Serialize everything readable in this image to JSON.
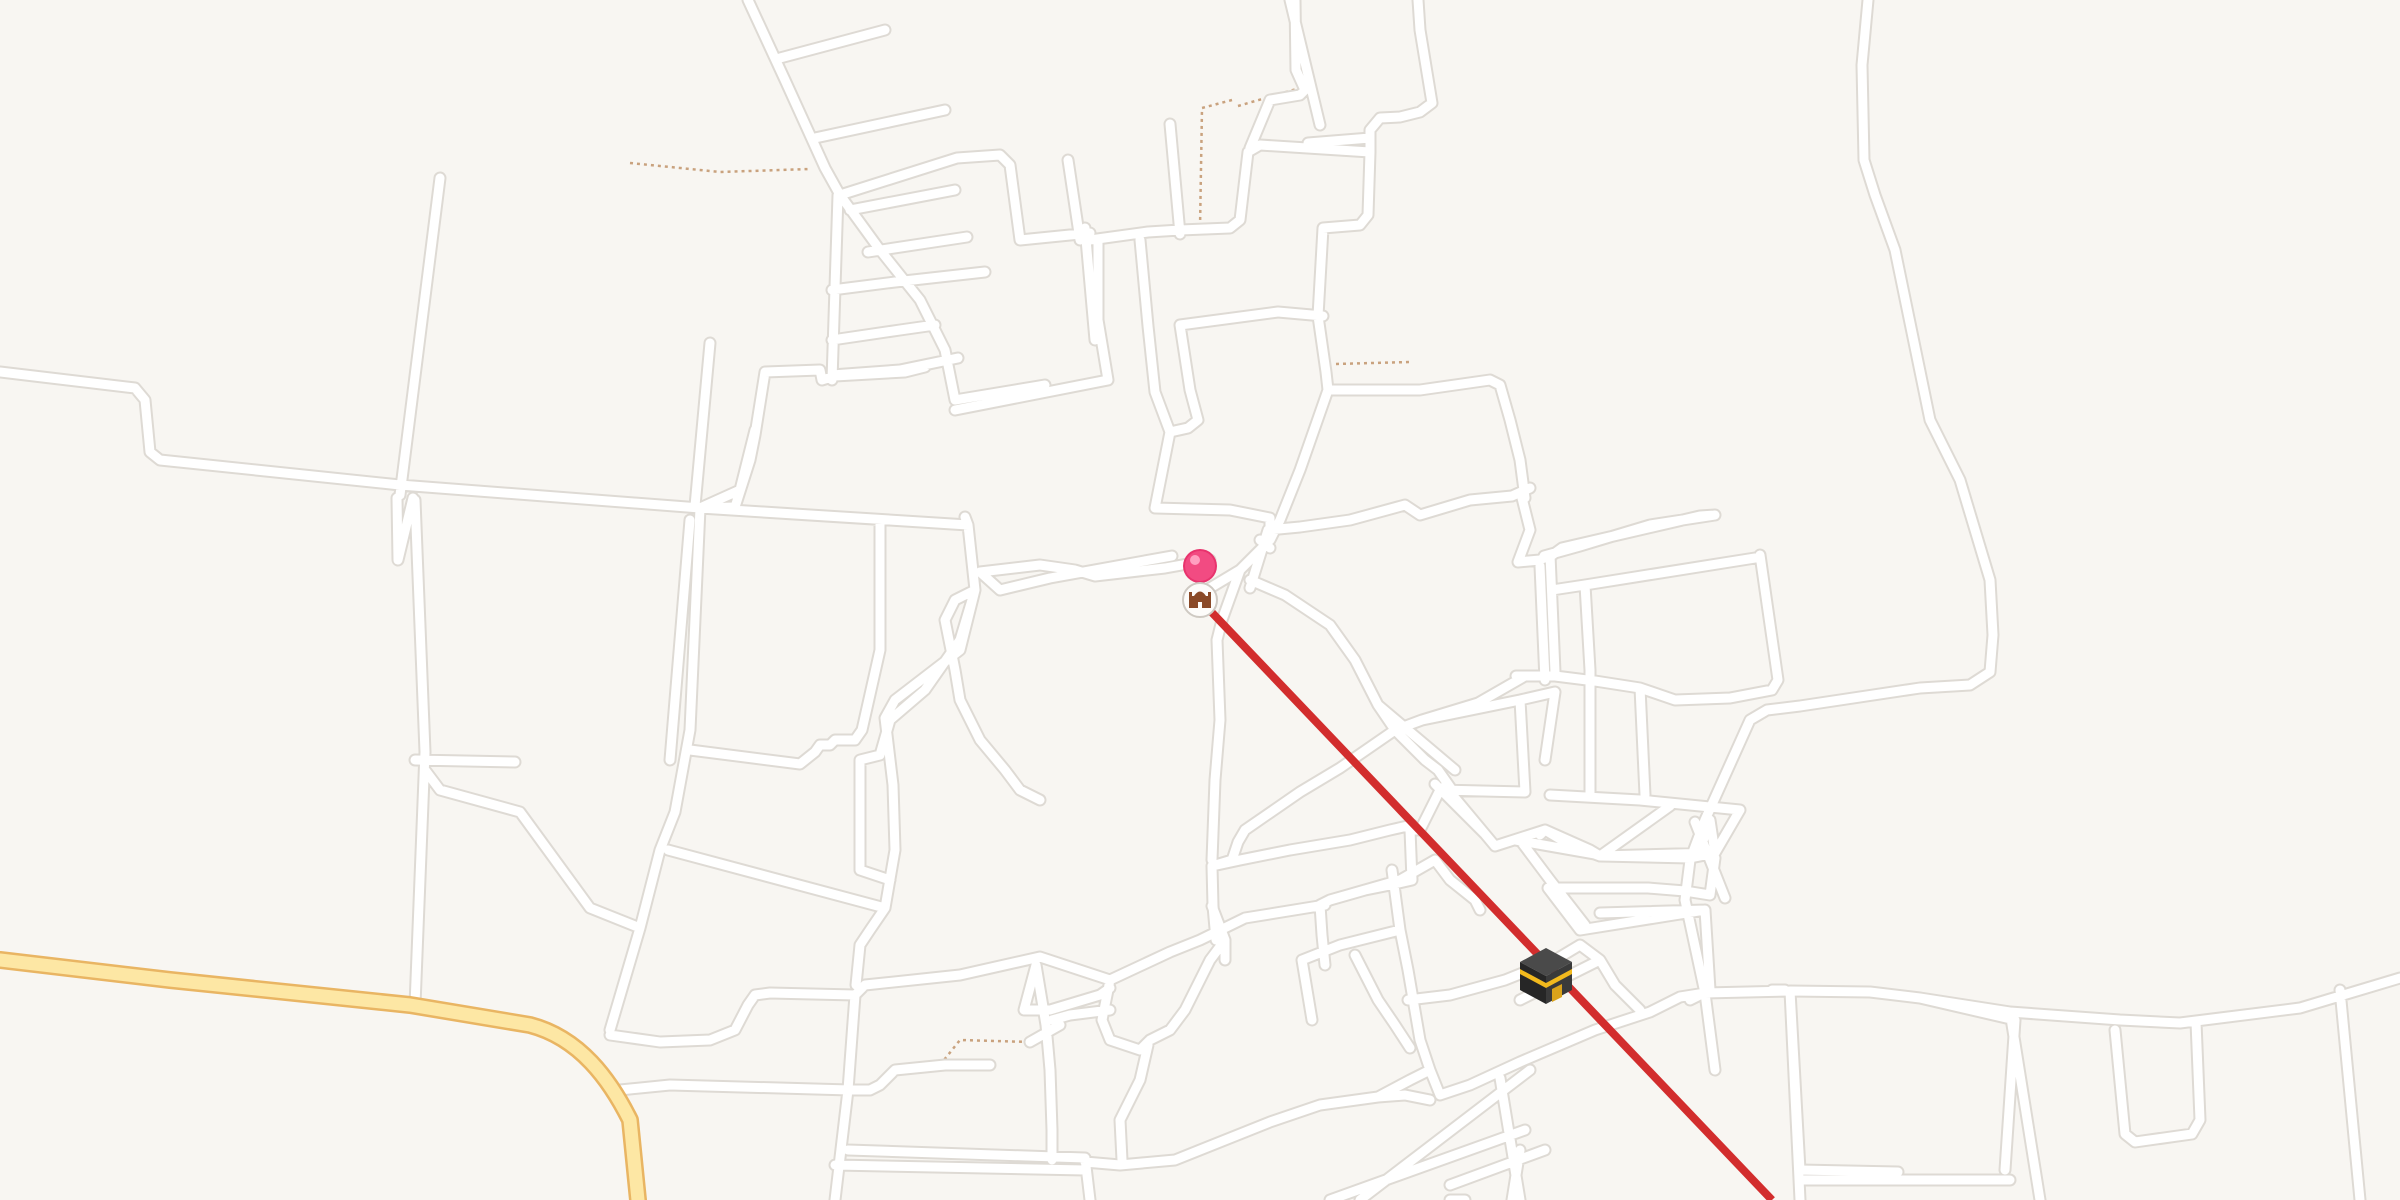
{
  "map": {
    "type": "street-map",
    "background_color": "#f8f6f2",
    "road_color": "#ffffff",
    "main_road_color": "#fde7a4",
    "track_color": "#c9a27e"
  },
  "markers": {
    "location_pin": {
      "icon": "location-pin-icon",
      "color": "#ef3d7a"
    },
    "mosque": {
      "icon": "mosque-icon"
    },
    "kaaba": {
      "icon": "kaaba-icon"
    }
  },
  "qibla_line": {
    "color": "#d22d2d"
  }
}
